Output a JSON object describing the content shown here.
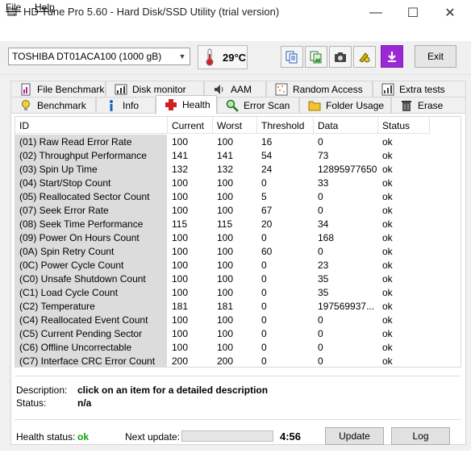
{
  "window": {
    "title": "HD Tune Pro 5.60 - Hard Disk/SSD Utility (trial version)",
    "controls": {
      "minimize": "—",
      "maximize": "☐",
      "close": "✕"
    }
  },
  "menu": {
    "file": "File",
    "help": "Help"
  },
  "toolbar": {
    "drive": "TOSHIBA DT01ACA100 (1000 gB)",
    "temperature": "29°C",
    "exit_label": "Exit",
    "icons": [
      "copy-text-icon",
      "copy-image-icon",
      "camera-icon",
      "options-icon",
      "save-icon"
    ]
  },
  "tabs": {
    "row1": [
      {
        "label": "File Benchmark",
        "icon": "file-benchmark-icon"
      },
      {
        "label": "Disk monitor",
        "icon": "disk-monitor-icon"
      },
      {
        "label": "AAM",
        "icon": "speaker-icon"
      },
      {
        "label": "Random Access",
        "icon": "random-access-icon"
      },
      {
        "label": "Extra tests",
        "icon": "extra-tests-icon"
      }
    ],
    "row2": [
      {
        "label": "Benchmark",
        "icon": "benchmark-icon"
      },
      {
        "label": "Info",
        "icon": "info-icon"
      },
      {
        "label": "Health",
        "icon": "health-cross-icon"
      },
      {
        "label": "Error Scan",
        "icon": "magnifier-icon"
      },
      {
        "label": "Folder Usage",
        "icon": "folder-icon"
      },
      {
        "label": "Erase",
        "icon": "trash-icon"
      }
    ],
    "active": "Health"
  },
  "smart": {
    "headers": [
      "ID",
      "Current",
      "Worst",
      "Threshold",
      "Data",
      "Status"
    ],
    "rows": [
      [
        "(01) Raw Read Error Rate",
        "100",
        "100",
        "16",
        "0",
        "ok"
      ],
      [
        "(02) Throughput Performance",
        "141",
        "141",
        "54",
        "73",
        "ok"
      ],
      [
        "(03) Spin Up Time",
        "132",
        "132",
        "24",
        "12895977650",
        "ok"
      ],
      [
        "(04) Start/Stop Count",
        "100",
        "100",
        "0",
        "33",
        "ok"
      ],
      [
        "(05) Reallocated Sector Count",
        "100",
        "100",
        "5",
        "0",
        "ok"
      ],
      [
        "(07) Seek Error Rate",
        "100",
        "100",
        "67",
        "0",
        "ok"
      ],
      [
        "(08) Seek Time Performance",
        "115",
        "115",
        "20",
        "34",
        "ok"
      ],
      [
        "(09) Power On Hours Count",
        "100",
        "100",
        "0",
        "168",
        "ok"
      ],
      [
        "(0A) Spin Retry Count",
        "100",
        "100",
        "60",
        "0",
        "ok"
      ],
      [
        "(0C) Power Cycle Count",
        "100",
        "100",
        "0",
        "23",
        "ok"
      ],
      [
        "(C0) Unsafe Shutdown Count",
        "100",
        "100",
        "0",
        "35",
        "ok"
      ],
      [
        "(C1) Load Cycle Count",
        "100",
        "100",
        "0",
        "35",
        "ok"
      ],
      [
        "(C2) Temperature",
        "181",
        "181",
        "0",
        "197569937...",
        "ok"
      ],
      [
        "(C4) Reallocated Event Count",
        "100",
        "100",
        "0",
        "0",
        "ok"
      ],
      [
        "(C5) Current Pending Sector",
        "100",
        "100",
        "0",
        "0",
        "ok"
      ],
      [
        "(C6) Offline Uncorrectable",
        "100",
        "100",
        "0",
        "0",
        "ok"
      ],
      [
        "(C7) Interface CRC Error Count",
        "200",
        "200",
        "0",
        "0",
        "ok"
      ]
    ]
  },
  "details": {
    "description_label": "Description:",
    "description_value": "click on an item for a detailed description",
    "status_label": "Status:",
    "status_value": "n/a"
  },
  "footer": {
    "health_label": "Health status:",
    "health_value": "ok",
    "next_update_label": "Next update:",
    "countdown": "4:56",
    "progress_fraction": 0.0,
    "update_label": "Update",
    "log_label": "Log",
    "colors": {
      "ok": "#0ba30b",
      "progress": "#06b025"
    }
  }
}
